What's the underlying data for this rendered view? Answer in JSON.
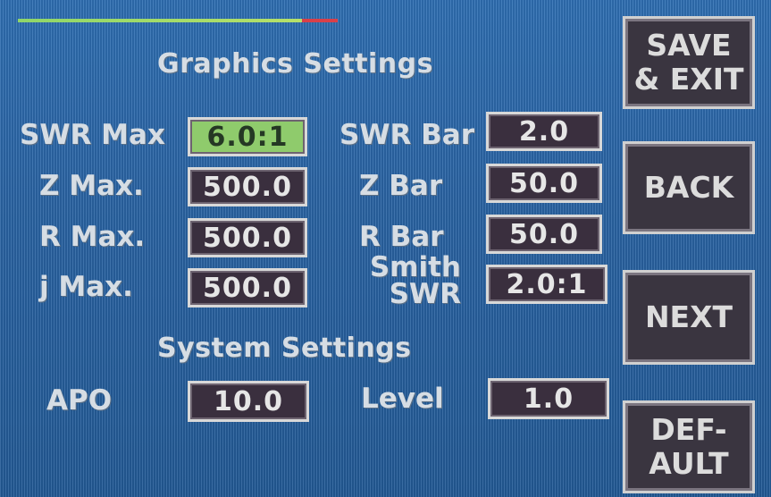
{
  "status_bar": {
    "good_color": "#8fd66a",
    "bad_color": "#d8404a"
  },
  "graphics": {
    "title": "Graphics Settings",
    "swr_max": {
      "label": "SWR Max",
      "value": "6.0:1"
    },
    "z_max": {
      "label": "Z  Max.",
      "value": "500.0"
    },
    "r_max": {
      "label": "R  Max.",
      "value": "500.0"
    },
    "j_max": {
      "label": "j  Max.",
      "value": "500.0"
    },
    "swr_bar": {
      "label": "SWR Bar",
      "value": "2.0"
    },
    "z_bar": {
      "label": "Z  Bar",
      "value": "50.0"
    },
    "r_bar": {
      "label": "R  Bar",
      "value": "50.0"
    },
    "smith_swr": {
      "label_line1": "Smith",
      "label_line2": "SWR",
      "value": "2.0:1"
    }
  },
  "system": {
    "title": "System Settings",
    "apo": {
      "label": "APO",
      "value": "10.0"
    },
    "level": {
      "label": "Level",
      "value": "1.0"
    }
  },
  "buttons": {
    "save_exit": "SAVE\n& EXIT",
    "back": "BACK",
    "next": "NEXT",
    "default": "DEF-\nAULT"
  },
  "colors": {
    "background": "#2a66a6",
    "field_bg": "#3a2f3e",
    "active_field_bg": "#8fcb6c",
    "text": "#d6dde4"
  }
}
